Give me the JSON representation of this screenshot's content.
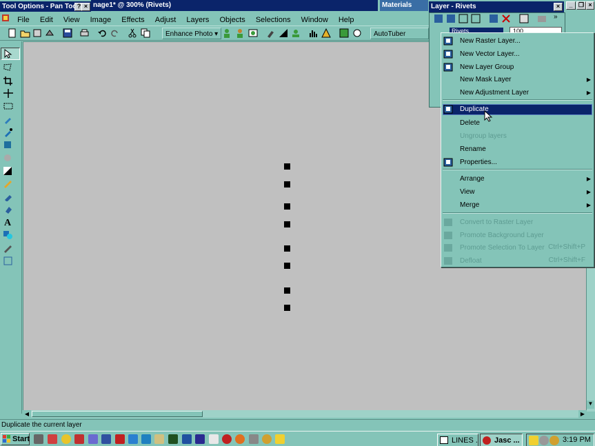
{
  "app": {
    "tool_options_title": "Tool Options - Pan Tool",
    "doc_title": "nage1* @ 300% (Rivets)",
    "materials_title": "Materials",
    "layer_title": "Layer - Rivets"
  },
  "menubar": [
    "File",
    "Edit",
    "View",
    "Image",
    "Effects",
    "Adjust",
    "Layers",
    "Objects",
    "Selections",
    "Window",
    "Help"
  ],
  "toolbar": {
    "enhance_photo": "Enhance Photo",
    "autotuber": "AutoTuber"
  },
  "layer_palette": {
    "layer_name": "Rivets",
    "opacity": "100"
  },
  "context_menu": {
    "items": [
      {
        "label": "New Raster Layer...",
        "enabled": true,
        "submenu": false
      },
      {
        "label": "New Vector Layer...",
        "enabled": true,
        "submenu": false
      },
      {
        "label": "New Layer Group",
        "enabled": true,
        "submenu": false
      },
      {
        "label": "New Mask Layer",
        "enabled": true,
        "submenu": true
      },
      {
        "label": "New Adjustment Layer",
        "enabled": true,
        "submenu": true
      },
      {
        "label": "Duplicate",
        "enabled": true,
        "submenu": false,
        "highlighted": true
      },
      {
        "label": "Delete",
        "enabled": true,
        "submenu": false
      },
      {
        "label": "Ungroup layers",
        "enabled": false,
        "submenu": false
      },
      {
        "label": "Rename",
        "enabled": true,
        "submenu": false
      },
      {
        "label": "Properties...",
        "enabled": true,
        "submenu": false
      },
      {
        "label": "Arrange",
        "enabled": true,
        "submenu": true
      },
      {
        "label": "View",
        "enabled": true,
        "submenu": true
      },
      {
        "label": "Merge",
        "enabled": true,
        "submenu": true
      },
      {
        "label": "Convert to Raster Layer",
        "enabled": false,
        "submenu": false
      },
      {
        "label": "Promote Background Layer",
        "enabled": false,
        "submenu": false
      },
      {
        "label": "Promote Selection To Layer",
        "enabled": false,
        "submenu": false,
        "shortcut": "Ctrl+Shift+P"
      },
      {
        "label": "Defloat",
        "enabled": false,
        "submenu": false,
        "shortcut": "Ctrl+Shift+F"
      }
    ]
  },
  "statusbar": {
    "text": "Duplicate the current layer"
  },
  "taskbar": {
    "start": "Start",
    "items": [
      "LINES ...",
      "Jasc ..."
    ],
    "time": "3:19 PM"
  },
  "colors": {
    "desktop": "#84c4b8",
    "title_active": "#0a246a",
    "highlight": "#0a246a",
    "canvas": "#c0c0c0"
  }
}
